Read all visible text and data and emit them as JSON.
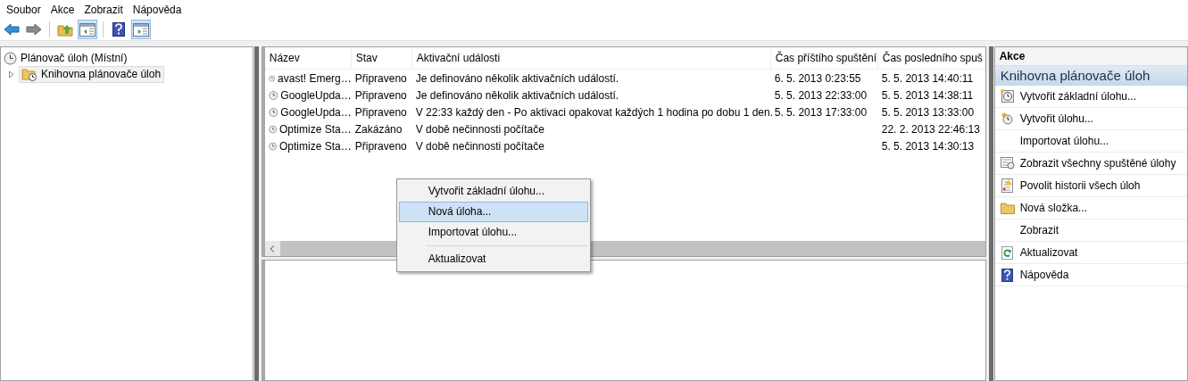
{
  "menu_bar": [
    "Soubor",
    "Akce",
    "Zobrazit",
    "Nápověda"
  ],
  "toolbar": [
    {
      "kind": "back",
      "pressed": false
    },
    {
      "kind": "forward",
      "pressed": false
    },
    {
      "kind": "sep"
    },
    {
      "kind": "up",
      "pressed": false
    },
    {
      "kind": "tree",
      "pressed": true
    },
    {
      "kind": "sep"
    },
    {
      "kind": "help",
      "pressed": false
    },
    {
      "kind": "actions",
      "pressed": true
    }
  ],
  "tree": {
    "label": "Plánovač úloh (Místní)",
    "children": [
      {
        "label": "Knihovna plánovače úloh",
        "expanded": false,
        "selected": true
      }
    ]
  },
  "table": {
    "columns": [
      "Název",
      "Stav",
      "Aktivační události",
      "Čas příštího spuštění",
      "Čas posledního spuš"
    ],
    "rows": [
      {
        "cells": [
          "avast! Emerg…",
          "Připraveno",
          "Je definováno několik aktivačních událostí.",
          "6. 5. 2013 0:23:55",
          "5. 5. 2013 14:40:11"
        ]
      },
      {
        "cells": [
          "GoogleUpda…",
          "Připraveno",
          "Je definováno několik aktivačních událostí.",
          "5. 5. 2013 22:33:00",
          "5. 5. 2013 14:38:11"
        ]
      },
      {
        "cells": [
          "GoogleUpda…",
          "Připraveno",
          "V 22:33 každý den - Po aktivaci opakovat každých 1 hodina po dobu 1 den.",
          "5. 5. 2013 17:33:00",
          "5. 5. 2013 13:33:00"
        ]
      },
      {
        "cells": [
          "Optimize Sta…",
          "Zakázáno",
          "V době nečinnosti počítače",
          "",
          "22. 2. 2013 22:46:13"
        ]
      },
      {
        "cells": [
          "Optimize Sta…",
          "Připraveno",
          "V době nečinnosti počítače",
          "",
          "5. 5. 2013 14:30:13"
        ]
      }
    ]
  },
  "context_menu": [
    {
      "label": "Vytvořit základní úlohu...",
      "selected": false,
      "separator_before": false
    },
    {
      "label": "Nová úloha...",
      "selected": true,
      "separator_before": false
    },
    {
      "label": "Importovat úlohu...",
      "selected": false,
      "separator_before": false
    },
    {
      "label": "Aktualizovat",
      "selected": false,
      "separator_before": true
    }
  ],
  "actions_pane": {
    "title": "Akce",
    "section": "Knihovna plánovače úloh",
    "items": [
      {
        "label": "Vytvořit základní úlohu...",
        "kind": "basic-task"
      },
      {
        "label": "Vytvořit úlohu...",
        "kind": "task"
      },
      {
        "label": "Importovat úlohu...",
        "kind": "plain"
      },
      {
        "label": "Zobrazit všechny spuštěné úlohy",
        "kind": "running"
      },
      {
        "label": "Povolit historii všech úloh",
        "kind": "history"
      },
      {
        "label": "Nová složka...",
        "kind": "folder"
      },
      {
        "label": "Zobrazit",
        "kind": "plain"
      },
      {
        "label": "Aktualizovat",
        "kind": "refresh"
      },
      {
        "label": "Nápověda",
        "kind": "help"
      }
    ]
  }
}
